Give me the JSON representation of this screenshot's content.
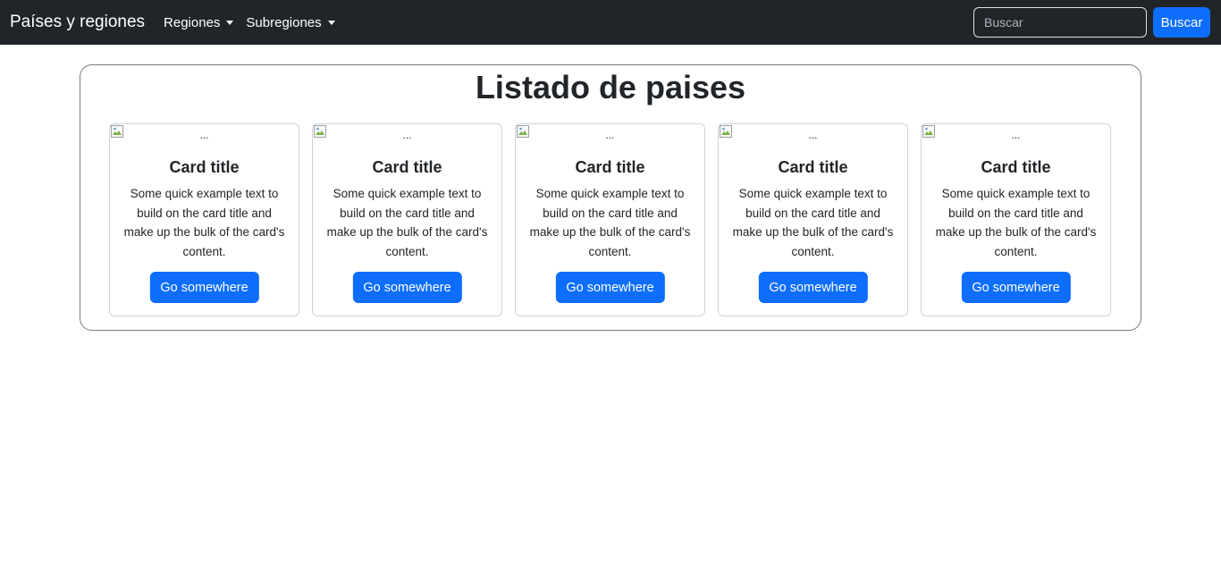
{
  "navbar": {
    "brand": "Países y regiones",
    "items": [
      {
        "label": "Regiones",
        "icon": "caret-down-icon"
      },
      {
        "label": "Subregiones",
        "icon": "caret-down-icon"
      }
    ],
    "search": {
      "placeholder": "Buscar",
      "value": "",
      "button_label": "Buscar"
    }
  },
  "main": {
    "title": "Listado de paises",
    "cards": [
      {
        "image_alt": "...",
        "image_icon": "broken-image-icon",
        "title": "Card title",
        "text": "Some quick example text to build on the card title and make up the bulk of the card's content.",
        "button_label": "Go somewhere"
      },
      {
        "image_alt": "...",
        "image_icon": "broken-image-icon",
        "title": "Card title",
        "text": "Some quick example text to build on the card title and make up the bulk of the card's content.",
        "button_label": "Go somewhere"
      },
      {
        "image_alt": "...",
        "image_icon": "broken-image-icon",
        "title": "Card title",
        "text": "Some quick example text to build on the card title and make up the bulk of the card's content.",
        "button_label": "Go somewhere"
      },
      {
        "image_alt": "...",
        "image_icon": "broken-image-icon",
        "title": "Card title",
        "text": "Some quick example text to build on the card title and make up the bulk of the card's content.",
        "button_label": "Go somewhere"
      },
      {
        "image_alt": "...",
        "image_icon": "broken-image-icon",
        "title": "Card title",
        "text": "Some quick example text to build on the card title and make up the bulk of the card's content.",
        "button_label": "Go somewhere"
      }
    ]
  },
  "colors": {
    "navbar_bg": "#212529",
    "primary": "#0d6efd",
    "text": "#212529"
  }
}
